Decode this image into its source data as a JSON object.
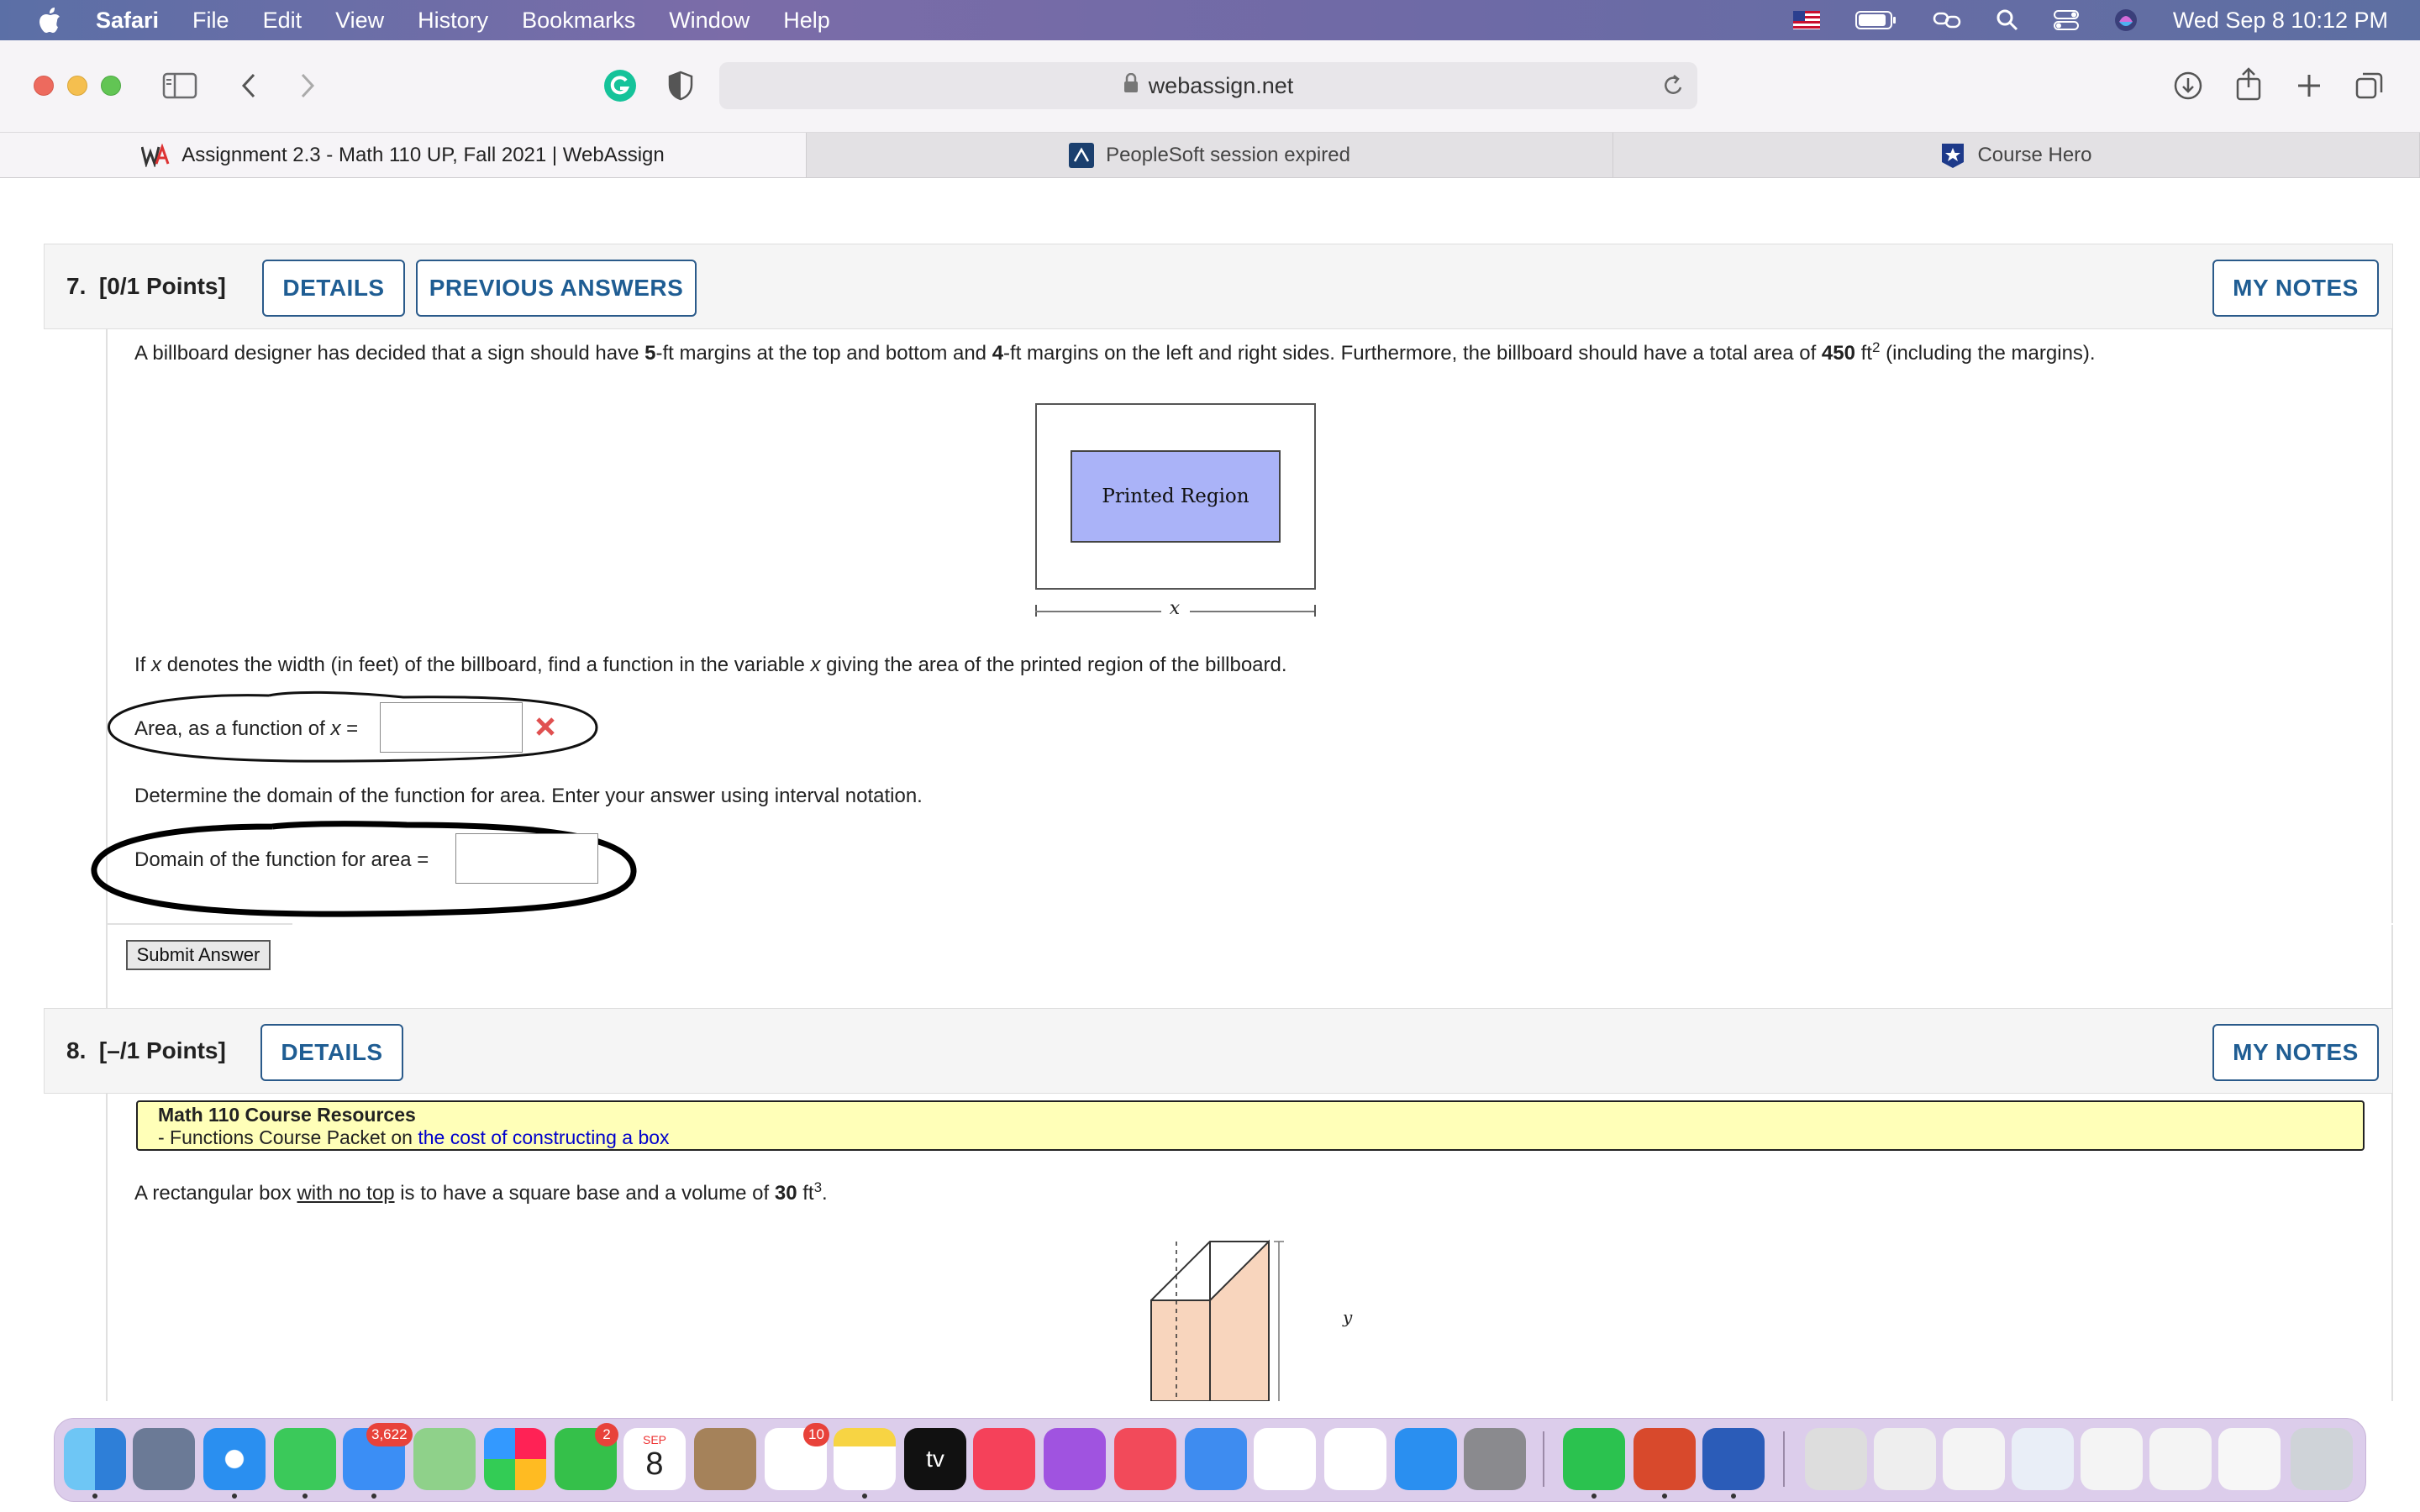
{
  "menubar": {
    "app": "Safari",
    "items": [
      "File",
      "Edit",
      "View",
      "History",
      "Bookmarks",
      "Window",
      "Help"
    ],
    "clock": "Wed Sep 8  10:12 PM"
  },
  "browser": {
    "address": "webassign.net",
    "tabs": [
      {
        "label": "Assignment 2.3 - Math 110 UP, Fall 2021 | WebAssign"
      },
      {
        "label": "PeopleSoft session expired"
      },
      {
        "label": "Course Hero"
      }
    ]
  },
  "q7": {
    "number": "7.",
    "points": "[0/1 Points]",
    "details": "DETAILS",
    "previous": "PREVIOUS ANSWERS",
    "notes": "MY NOTES",
    "p1": "A billboard designer has decided that a sign should have",
    "m1": "5",
    "p2": "-ft margins at the top and bottom and",
    "m2": "4",
    "p3": "-ft margins on the left and right sides. Furthermore, the billboard should have a total area of",
    "area": "450",
    "unit": "ft",
    "exp": "2",
    "p4": "(including the margins).",
    "fig_label": "Printed Region",
    "fig_x": "x",
    "q_a": "If",
    "q_var": "x",
    "q_b": "denotes the width (in feet) of the billboard, find a function in the variable",
    "q_var2": "x",
    "q_c": "giving the area of the printed region of the billboard.",
    "area_label": "Area, as a function of",
    "area_var": "x",
    "area_eq": "=",
    "area_value": "",
    "domain_prompt": "Determine the domain of the function for area. Enter your answer using interval notation.",
    "domain_label": "Domain of the function for area =",
    "domain_value": "",
    "submit": "Submit Answer"
  },
  "q8": {
    "number": "8.",
    "points": "[–/1 Points]",
    "details": "DETAILS",
    "notes": "MY NOTES",
    "res_title": "Math 110 Course Resources",
    "res_prefix": "- Functions Course Packet on",
    "res_link": "the cost of constructing a box",
    "t1": "A rectangular box",
    "t_under": "with no top",
    "t2": "is to have a square base and a volume of",
    "vol": "30",
    "unit": "ft",
    "exp": "3",
    "t3": ".",
    "fig_y": "y"
  },
  "dock": {
    "mail_badge": "3,622",
    "facetime_badge": "2",
    "calendar_month": "SEP",
    "calendar_day": "8",
    "reminders_badge": "10",
    "tv_label": "tv"
  },
  "colors": {
    "accent": "#1f5d93",
    "printed_region": "#aab3f8",
    "box_fill": "#f8d5bd",
    "resource_bg": "#ffffb8",
    "wrong_mark": "#e05050"
  }
}
